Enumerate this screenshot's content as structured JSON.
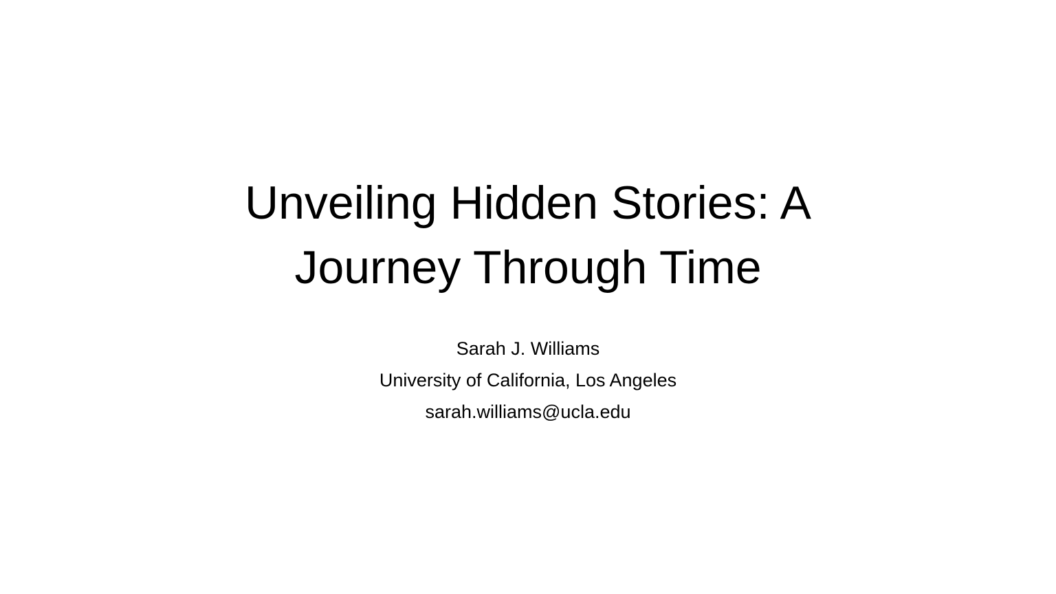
{
  "slide": {
    "title_lines": [
      "Unveiling Hidden Stories: A",
      "Journey Through Time"
    ],
    "author": "Sarah J. Williams",
    "affiliation": "University of California, Los Angeles",
    "email": "sarah.williams@ucla.edu"
  }
}
